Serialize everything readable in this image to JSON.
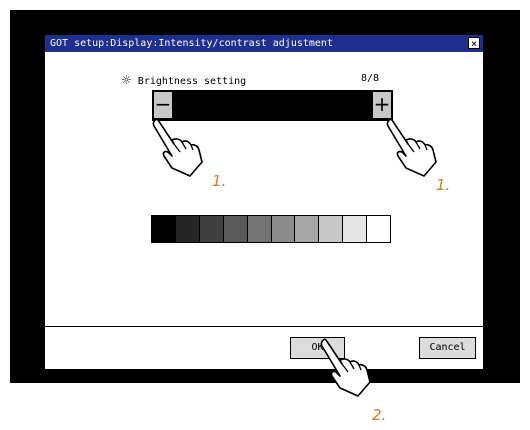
{
  "window": {
    "title": "GOT setup:Display:Intensity/contrast adjustment",
    "close_symbol": "×"
  },
  "brightness": {
    "label": "Brightness setting",
    "value": "8/8",
    "minus_label": "−",
    "plus_label": "+",
    "icon": "sun-icon"
  },
  "contrast_strip": {
    "cells": [
      "#000000",
      "#262626",
      "#404040",
      "#595959",
      "#737373",
      "#8c8c8c",
      "#a6a6a6",
      "#c8c8c8",
      "#e6e6e6",
      "#ffffff"
    ]
  },
  "buttons": {
    "ok_label": "OK",
    "cancel_label": "Cancel"
  },
  "callouts": {
    "step1_left": "1.",
    "step1_right": "1.",
    "step2": "2.",
    "color": "#e8731c"
  }
}
